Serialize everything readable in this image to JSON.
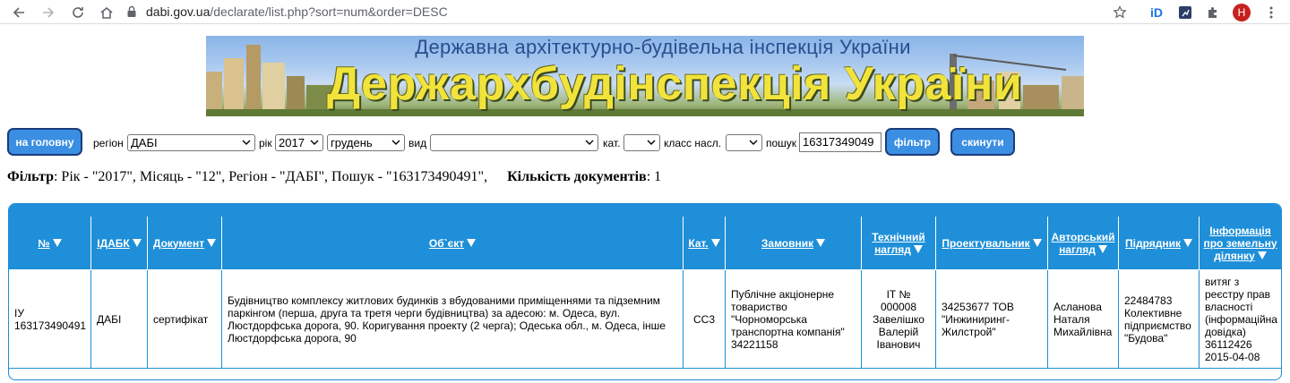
{
  "browser": {
    "url_host": "dabi.gov.ua",
    "url_path": "/declarate/list.php?sort=num&order=DESC",
    "profile_initial": "H"
  },
  "banner": {
    "subtitle": "Державна архітектурно-будівельна інспекція України",
    "title": "Держархбудінспекція України"
  },
  "filters": {
    "home_button": "на головну",
    "region_label": "регіон",
    "region_value": "ДАБІ",
    "year_label": "рік",
    "year_value": "2017",
    "month_value": "грудень",
    "type_label": "вид",
    "type_value": "",
    "cat_label": "кат.",
    "cat_value": "",
    "class_label": "класс насл.",
    "class_value": "",
    "search_label": "пошук",
    "search_value": "16317349049",
    "filter_button": "фільтр",
    "reset_button": "скинути"
  },
  "summary": {
    "filter_label": "Фільтр",
    "filter_text": ": Рік - \"2017\", Місяць - \"12\", Регіон - \"ДАБІ\", Пошук - \"163173490491\",",
    "count_label": "Кількість документів",
    "count_text": ": 1"
  },
  "table": {
    "headers": [
      {
        "line1": "№",
        "line2": ""
      },
      {
        "line1": "ІДАБК",
        "line2": ""
      },
      {
        "line1": "Документ",
        "line2": ""
      },
      {
        "line1": "Об`єкт",
        "line2": ""
      },
      {
        "line1": "Кат.",
        "line2": ""
      },
      {
        "line1": "Замовник",
        "line2": ""
      },
      {
        "line1": "Технічний",
        "line2": "нагляд"
      },
      {
        "line1": "Проектувальник",
        "line2": ""
      },
      {
        "line1": "Авторський",
        "line2": "нагляд"
      },
      {
        "line1": "Підрядник",
        "line2": ""
      },
      {
        "line1": "Інформація",
        "line2": "про земельну",
        "line3": "ділянку"
      }
    ],
    "rows": [
      {
        "num": "ІУ 163173490491",
        "idabk": "ДАБІ",
        "doc": "сертифікат",
        "object": "Будівництво комплексу житлових будинків з вбудованими приміщеннями та підземним паркінгом (перша, друга та третя черги будівництва) за адесою: м. Одеса, вул. Люстдорфська дорога, 90. Коригування проекту (2 черга); Одеська обл., м. Одеса, інше Люстдорфська дорога, 90",
        "cat": "СС3",
        "customer": "Публічне акціонерне товариство \"Чорноморська транспортна компанія\" 34221158",
        "tech": "ІТ № 000008 Завелішко Валерій Іванович",
        "designer": "34253677 ТОВ \"Инжиниринг-Жилстрой\"",
        "author": "Асланова Наталя Михайлівна",
        "contractor": "22484783 Колективне підприємство \"Будова\"",
        "land": "витяг з реєстру прав власності (інформаційна довідка) 36112426 2015-04-08"
      }
    ]
  }
}
